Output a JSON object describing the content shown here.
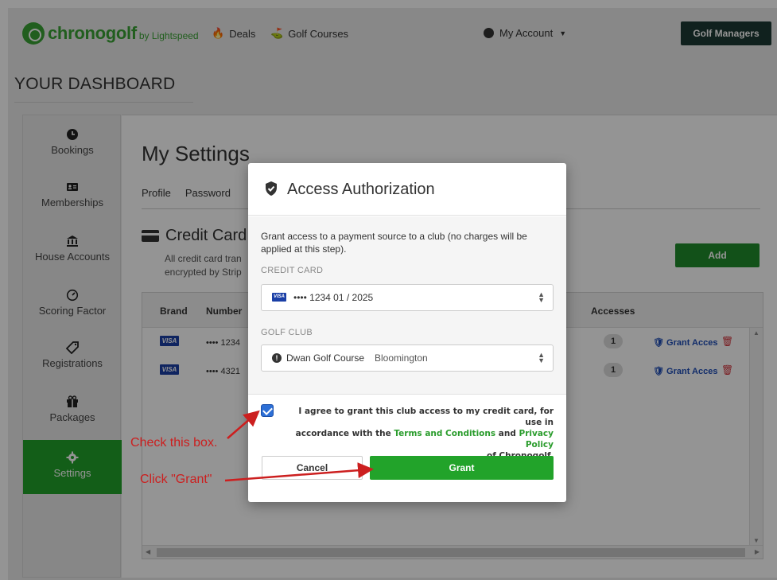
{
  "nav": {
    "logo_text": "chronogolf",
    "logo_sub": "by Lightspeed",
    "deals_label": "Deals",
    "courses_label": "Golf Courses",
    "account_label": "My Account",
    "managers_label": "Golf Managers"
  },
  "dashboard_title": "YOUR DASHBOARD",
  "sidebar": {
    "items": [
      {
        "label": "Bookings",
        "icon": "clock-icon"
      },
      {
        "label": "Memberships",
        "icon": "id-card-icon"
      },
      {
        "label": "House Accounts",
        "icon": "bank-icon"
      },
      {
        "label": "Scoring Factor",
        "icon": "gauge-icon"
      },
      {
        "label": "Registrations",
        "icon": "tag-icon"
      },
      {
        "label": "Packages",
        "icon": "gift-icon"
      },
      {
        "label": "Settings",
        "icon": "gear-icon"
      }
    ]
  },
  "main": {
    "title": "My Settings",
    "tabs": [
      "Profile",
      "Password"
    ],
    "cc_title": "Credit Card",
    "cc_desc_1": "All credit card tran",
    "cc_desc_2": "encrypted by Strip",
    "add_label": "Add",
    "table": {
      "headers": [
        "Brand",
        "Number",
        "Accesses"
      ],
      "rows": [
        {
          "brand": "VISA",
          "number": "•••• 1234",
          "accesses": "1",
          "action": "Grant Acces"
        },
        {
          "brand": "VISA",
          "number": "•••• 4321",
          "accesses": "1",
          "action": "Grant Acces"
        }
      ]
    }
  },
  "modal": {
    "title": "Access Authorization",
    "description": "Grant access to a payment source to a club (no charges will be applied at this step).",
    "card_label": "CREDIT CARD",
    "card_value": "•••• 1234   01 / 2025",
    "card_brand": "VISA",
    "club_label": "GOLF CLUB",
    "club_name": "Dwan Golf Course",
    "club_city": "Bloomington",
    "agree_1": "I agree to grant this club access to my credit card, for use in",
    "agree_2a": "accordance with the ",
    "terms_link": "Terms and Conditions",
    "agree_2b": " and ",
    "privacy_link": "Privacy Policy",
    "agree_3": "of Chronogolf.",
    "checked": true,
    "cancel_label": "Cancel",
    "grant_label": "Grant"
  },
  "annotations": {
    "check_box": "Check this box.",
    "click_grant": "Click \"Grant\""
  },
  "colors": {
    "brand_green": "#3aa335",
    "button_green": "#22a32a",
    "dark_button": "#1d3a35",
    "link_blue": "#1e4db7",
    "annotation_red": "#cc1f1f"
  }
}
